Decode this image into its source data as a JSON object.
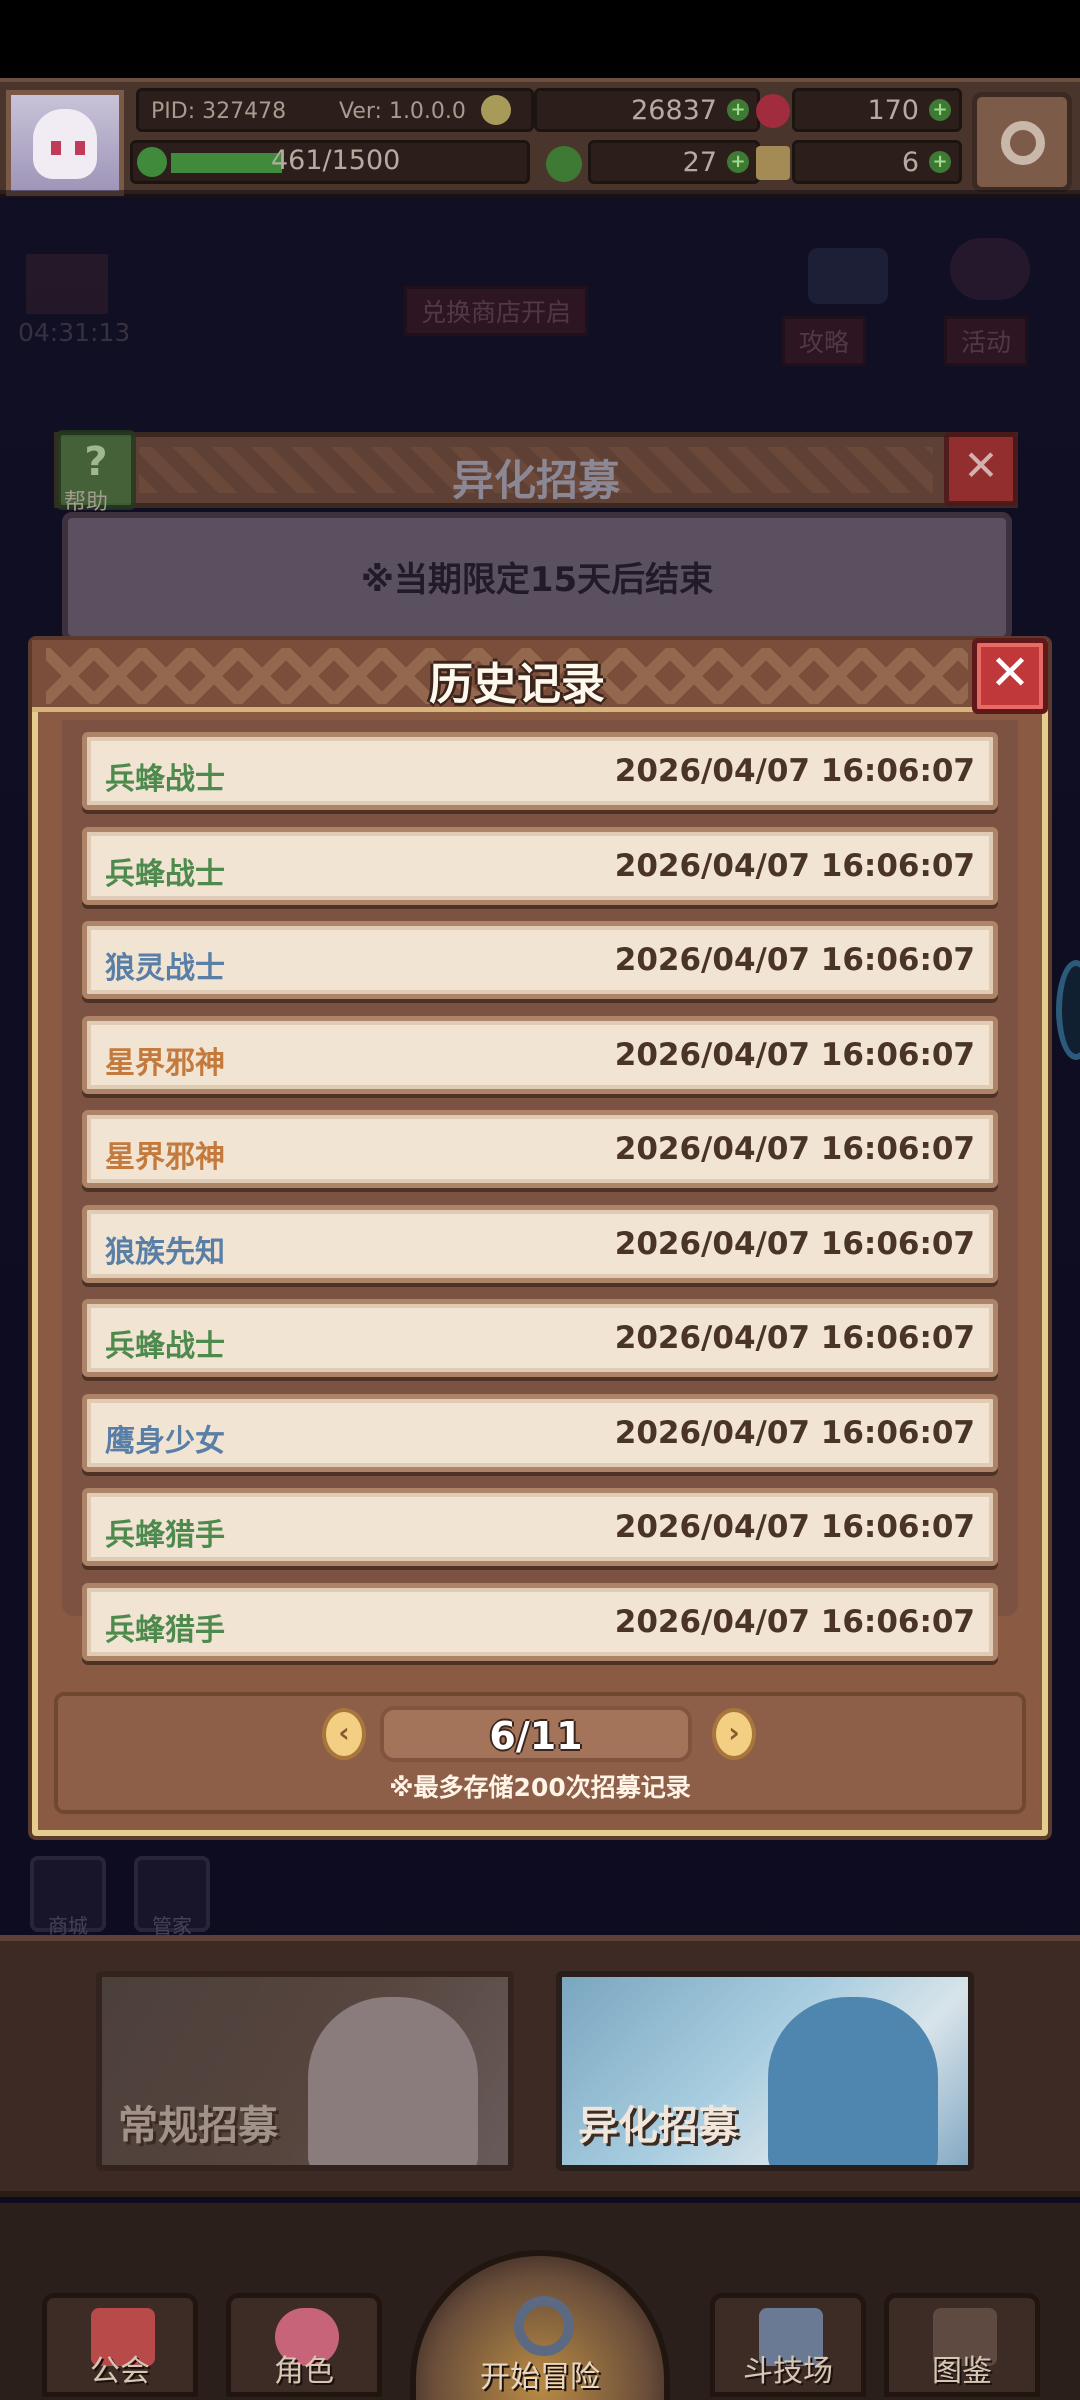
{
  "hud": {
    "pid": "PID: 327478",
    "version": "Ver: 1.0.0.0",
    "xp": "461/1500",
    "xp_fraction": 0.307,
    "gold": "26837",
    "gems": "170",
    "clover": "27",
    "keys": "6"
  },
  "scene": {
    "timer": "04:31:13",
    "shop_notice": "兑换商店开启",
    "btn_guide": "攻略",
    "btn_event": "活动",
    "help_label": "帮助",
    "icon_a": "商城",
    "icon_b": "管家"
  },
  "recruit": {
    "title": "异化招募",
    "notice": "※当期限定15天后结束"
  },
  "history": {
    "title": "历史记录",
    "close_glyph": "✕",
    "page": "6/11",
    "note": "※最多存储200次招募记录",
    "rows": [
      {
        "name": "兵蜂战士",
        "time": "2026/04/07 16:06:07"
      },
      {
        "name": "兵蜂战士",
        "time": "2026/04/07 16:06:07"
      },
      {
        "name": "狼灵战士",
        "time": "2026/04/07 16:06:07"
      },
      {
        "name": "星界邪神",
        "time": "2026/04/07 16:06:07"
      },
      {
        "name": "星界邪神",
        "time": "2026/04/07 16:06:07"
      },
      {
        "name": "狼族先知",
        "time": "2026/04/07 16:06:07"
      },
      {
        "name": "兵蜂战士",
        "time": "2026/04/07 16:06:07"
      },
      {
        "name": "鹰身少女",
        "time": "2026/04/07 16:06:07"
      },
      {
        "name": "兵蜂猎手",
        "time": "2026/04/07 16:06:07"
      },
      {
        "name": "兵蜂猎手",
        "time": "2026/04/07 16:06:07"
      }
    ]
  },
  "banners": {
    "normal": "常规招募",
    "special": "异化招募"
  },
  "nav": {
    "guild": "公会",
    "role": "角色",
    "start": "开始冒险",
    "arena": "斗技场",
    "codex": "图鉴"
  },
  "colors": {
    "name_green": "#4e8a4d",
    "name_blue": "#5a7fa6",
    "name_orange": "#c47a3c",
    "row_name_colors": [
      "#4e8a4d",
      "#4e8a4d",
      "#5a7fa6",
      "#c47a3c",
      "#c47a3c",
      "#5a7fa6",
      "#4e8a4d",
      "#5a7fa6",
      "#4e8a4d",
      "#4e8a4d"
    ]
  }
}
